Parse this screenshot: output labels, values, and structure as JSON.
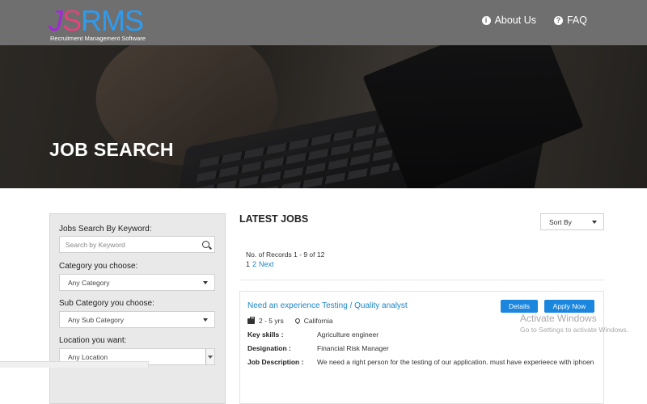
{
  "header": {
    "logo": {
      "mark_j": "J",
      "mark_s": "S",
      "mark_rms": "RMS",
      "subtitle": "Recruitment Management Software"
    },
    "nav": [
      {
        "label": "About Us",
        "icon": "info-icon"
      },
      {
        "label": "FAQ",
        "icon": "question-icon"
      }
    ]
  },
  "hero": {
    "title": "JOB SEARCH"
  },
  "sidebar": {
    "keyword": {
      "label": "Jobs Search By Keyword:",
      "placeholder": "Search by Keyword"
    },
    "category": {
      "label": "Category you choose:",
      "value": "Any Category"
    },
    "subcategory": {
      "label": "Sub Category you choose:",
      "value": "Any Sub Category"
    },
    "location": {
      "label": "Location you want:",
      "value": "Any Location"
    }
  },
  "main": {
    "title": "LATEST JOBS",
    "sort": {
      "value": "Sort By"
    },
    "records": "No. of Records 1 - 9 of 12",
    "pager": {
      "current": "1",
      "next_page": "2",
      "next_label": "Next"
    },
    "job": {
      "title": "Need an experience Testing / Quality analyst",
      "details_label": "Details",
      "apply_label": "Apply Now",
      "experience": "2 - 5 yrs",
      "location": "California",
      "rows": [
        {
          "key": "Key skills :",
          "value": "Agriculture engineer"
        },
        {
          "key": "Designation :",
          "value": "Financial Risk Manager"
        },
        {
          "key": "Job Description :",
          "value": "We need a right person for the testing of our application. must have experieece with iphoen"
        }
      ]
    }
  },
  "watermark": {
    "title": "Activate Windows",
    "subtitle": "Go to Settings to activate Windows."
  },
  "colors": {
    "header_bg": "#6f6f6f",
    "link": "#1a86c8",
    "button": "#1a86de"
  }
}
